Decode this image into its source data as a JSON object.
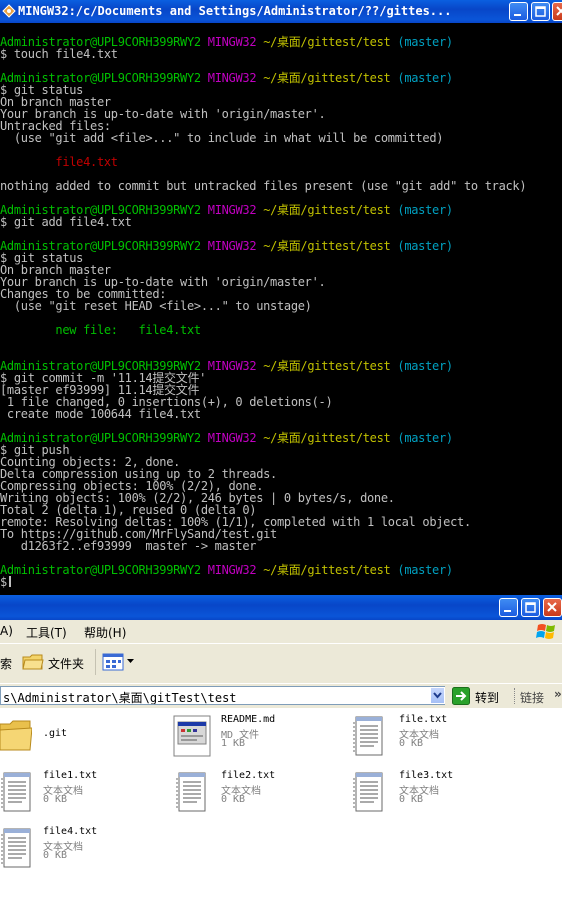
{
  "terminal": {
    "title": "MINGW32:/c/Documents and Settings/Administrator/??/gittes...",
    "prompt": {
      "user_host": "Administrator@UPL9CORH399RWY2",
      "system": "MINGW32",
      "path": "~/桌面/gittest/test",
      "branch": "(master)"
    },
    "commands": {
      "c1": "$ touch file4.txt",
      "c2": "$ git status",
      "c3": "$ git add file4.txt",
      "c4": "$ git status",
      "c5": "$ git commit -m '11.14提交文件'",
      "c6": "$ git push",
      "c7": "$"
    },
    "output": {
      "s1_l1": "On branch master",
      "s1_l2": "Your branch is up-to-date with 'origin/master'.",
      "s1_l3": "Untracked files:",
      "s1_l4": "  (use \"git add <file>...\" to include in what will be committed)",
      "s1_file": "        file4.txt",
      "s1_l5": "nothing added to commit but untracked files present (use \"git add\" to track)",
      "s2_l1": "On branch master",
      "s2_l2": "Your branch is up-to-date with 'origin/master'.",
      "s2_l3": "Changes to be committed:",
      "s2_l4": "  (use \"git reset HEAD <file>...\" to unstage)",
      "s2_file": "        new file:   file4.txt",
      "commit_l1": "[master ef93999] 11.14提交文件",
      "commit_l2": " 1 file changed, 0 insertions(+), 0 deletions(-)",
      "commit_l3": " create mode 100644 file4.txt",
      "push_l1": "Counting objects: 2, done.",
      "push_l2": "Delta compression using up to 2 threads.",
      "push_l3": "Compressing objects: 100% (2/2), done.",
      "push_l4": "Writing objects: 100% (2/2), 246 bytes | 0 bytes/s, done.",
      "push_l5": "Total 2 (delta 1), reused 0 (delta 0)",
      "push_l6": "remote: Resolving deltas: 100% (1/1), completed with 1 local object.",
      "push_l7": "To https://github.com/MrFlySand/test.git",
      "push_l8": "   d1263f2..ef93999  master -> master"
    }
  },
  "explorer": {
    "menu": {
      "tools": "工具(T)",
      "help": "帮助(H)",
      "partial_left": "A)"
    },
    "toolbar": {
      "search_partial": "索",
      "folders": "文件夹"
    },
    "address": {
      "value": "s\\Administrator\\桌面\\gitTest\\test",
      "go": "转到",
      "links": "链接"
    },
    "files": [
      {
        "name": ".git",
        "type": "",
        "size": "",
        "icon": "folder-icon"
      },
      {
        "name": "README.md",
        "type": "MD 文件",
        "size": "1 KB",
        "icon": "document-icon"
      },
      {
        "name": "file.txt",
        "type": "文本文档",
        "size": "0 KB",
        "icon": "text-file-icon"
      },
      {
        "name": "file1.txt",
        "type": "文本文档",
        "size": "0 KB",
        "icon": "text-file-icon"
      },
      {
        "name": "file2.txt",
        "type": "文本文档",
        "size": "0 KB",
        "icon": "text-file-icon"
      },
      {
        "name": "file3.txt",
        "type": "文本文档",
        "size": "0 KB",
        "icon": "text-file-icon"
      },
      {
        "name": "file4.txt",
        "type": "文本文档",
        "size": "0 KB",
        "icon": "text-file-icon"
      }
    ]
  },
  "colors": {
    "titlebar": "#0a5fe0",
    "prompt_user": "#00c000",
    "prompt_mingw": "#c000c0",
    "prompt_path": "#c0c000",
    "prompt_branch": "#00a0c0",
    "untracked": "#c00000",
    "staged": "#00c000"
  }
}
